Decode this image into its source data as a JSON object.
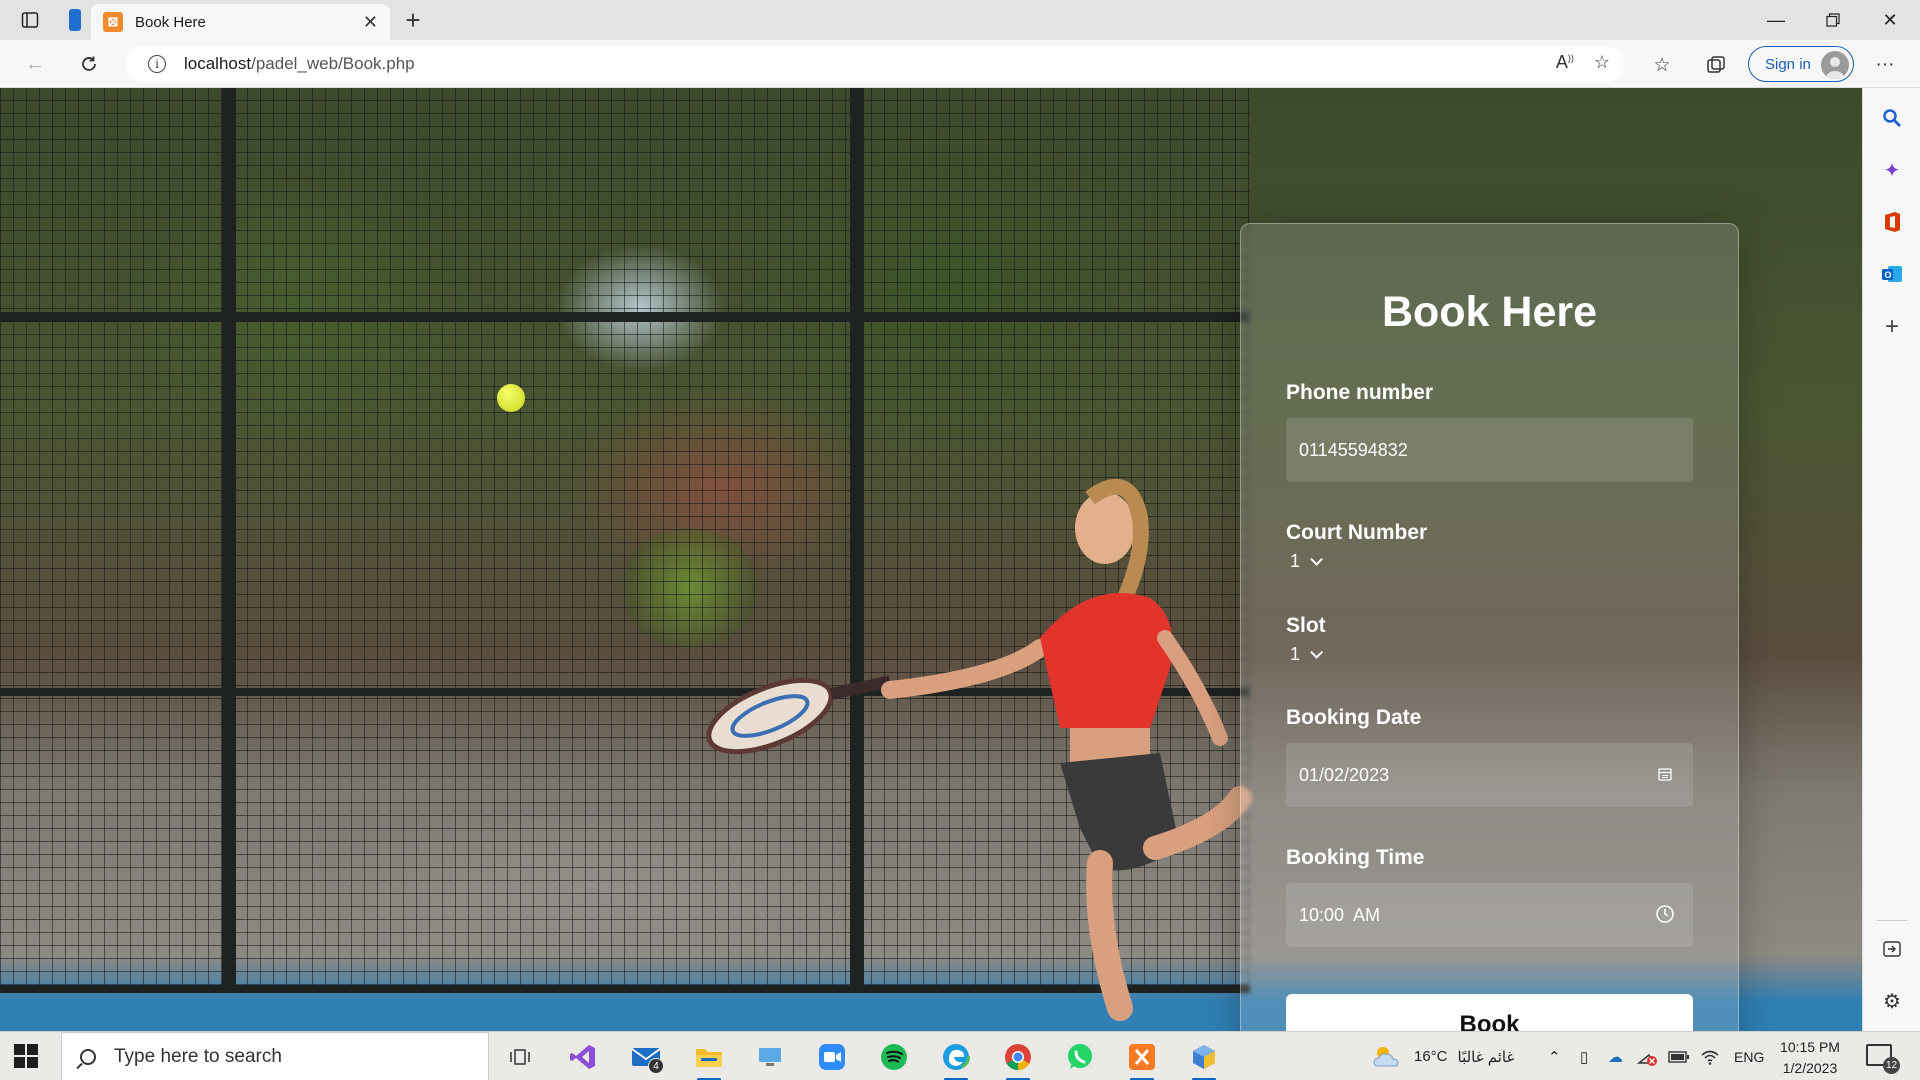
{
  "browser": {
    "tab_title": "Book Here",
    "url_host": "localhost",
    "url_path": "/padel_web/Book.php",
    "signin_label": "Sign in"
  },
  "form": {
    "title": "Book Here",
    "phone_label": "Phone number",
    "phone_value": "01145594832",
    "court_label": "Court Number",
    "court_value": "1",
    "slot_label": "Slot",
    "slot_value": "1",
    "date_label": "Booking Date",
    "date_value": "01/02/2023",
    "time_label": "Booking Time",
    "time_value": "10:00  AM",
    "book_button": "Book"
  },
  "taskbar": {
    "search_placeholder": "Type here to search",
    "mail_badge": "4",
    "weather_temp": "16°C",
    "weather_text": "غائم غالبًا",
    "language": "ENG",
    "time": "10:15 PM",
    "date": "1/2/2023",
    "notification_count": "12"
  }
}
